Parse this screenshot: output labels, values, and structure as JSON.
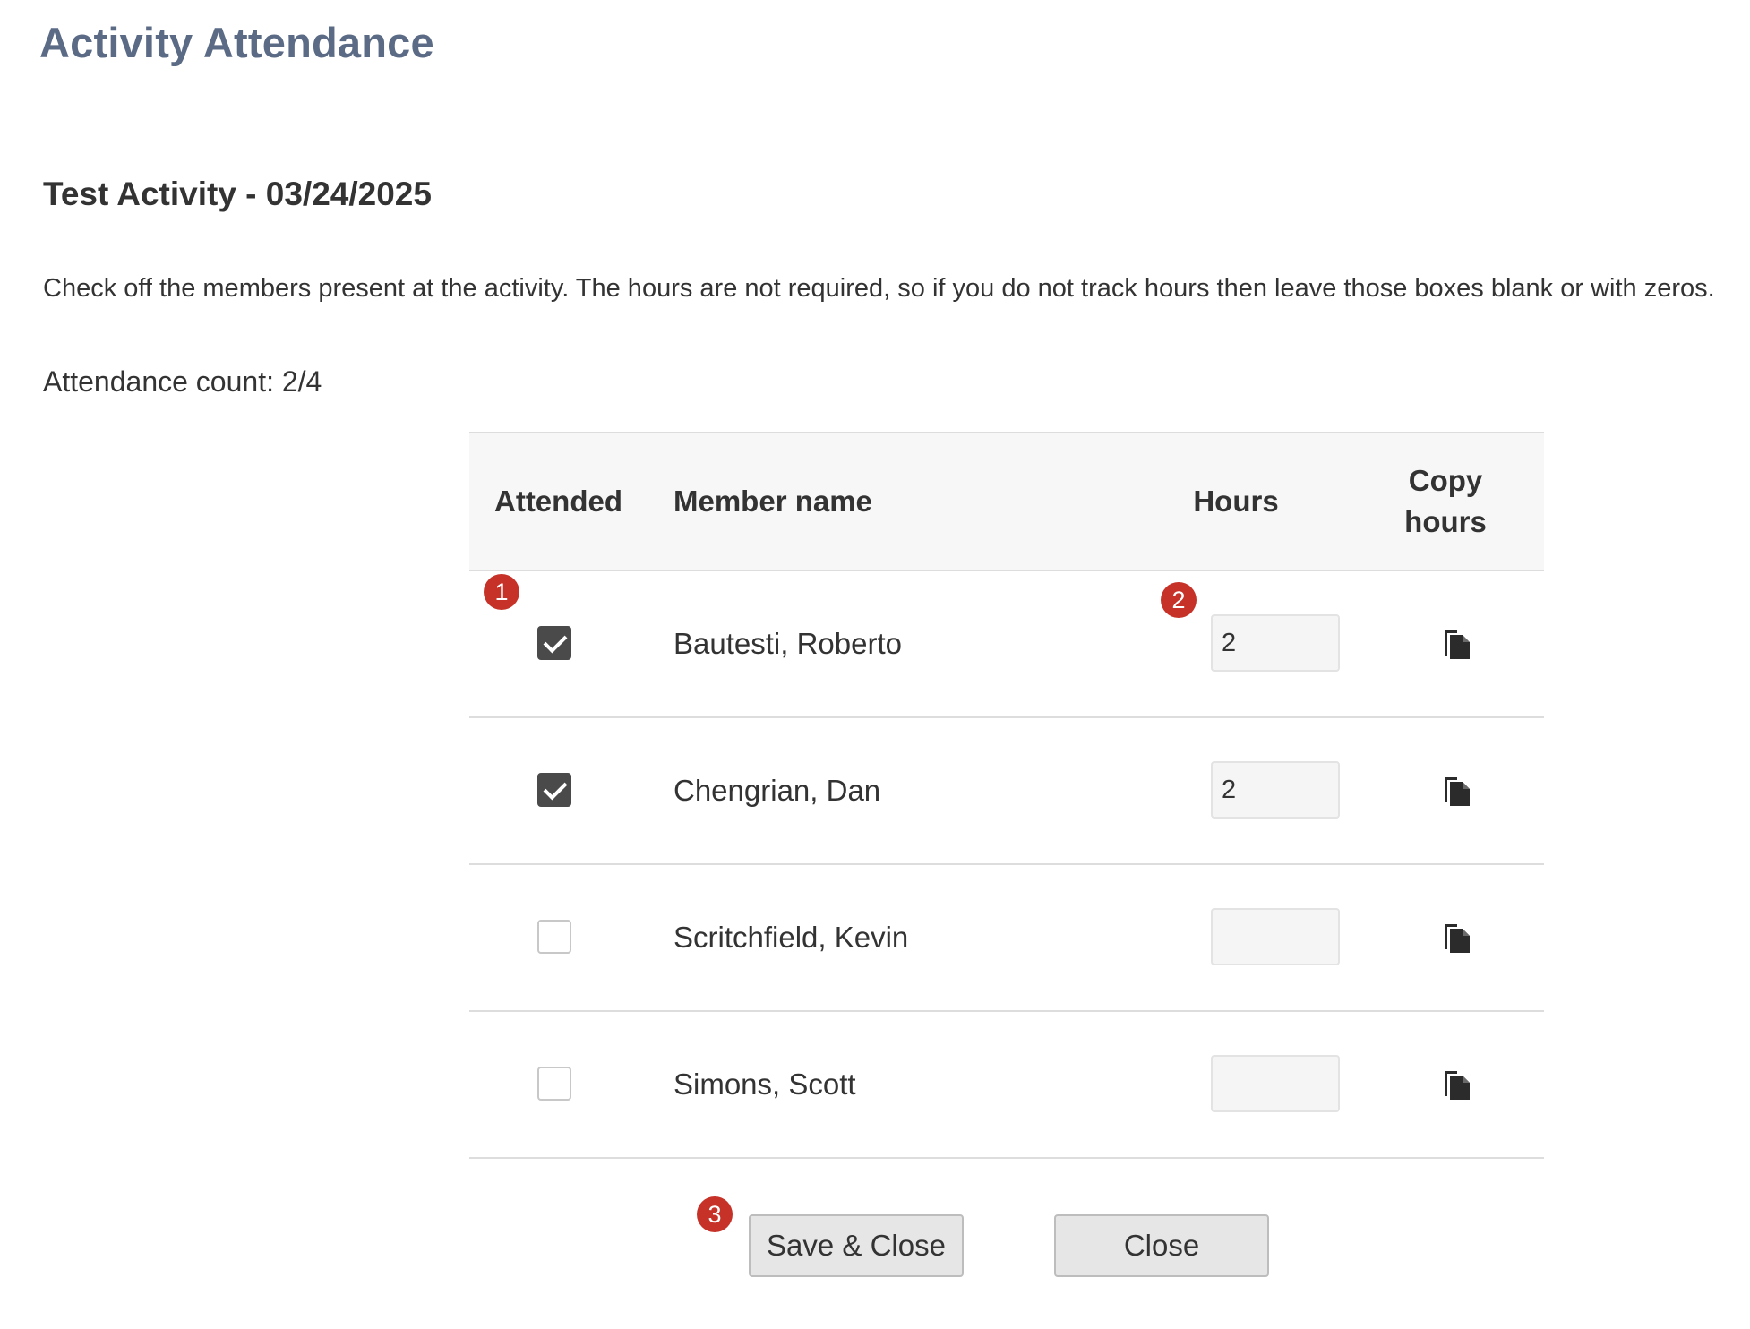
{
  "page": {
    "title": "Activity Attendance"
  },
  "activity": {
    "title": "Test Activity - 03/24/2025",
    "instructions": "Check off the members present at the activity. The hours are not required, so if you do not track hours then leave those boxes blank or with zeros.",
    "attendance_count": "Attendance count: 2/4"
  },
  "table": {
    "headers": {
      "attended": "Attended",
      "member_name": "Member name",
      "hours": "Hours",
      "copy_hours": "Copy hours"
    },
    "rows": [
      {
        "attended": true,
        "member_name": "Bautesti, Roberto",
        "hours": "2"
      },
      {
        "attended": true,
        "member_name": "Chengrian, Dan",
        "hours": "2"
      },
      {
        "attended": false,
        "member_name": "Scritchfield, Kevin",
        "hours": ""
      },
      {
        "attended": false,
        "member_name": "Simons, Scott",
        "hours": ""
      }
    ],
    "copy_icon": "copy-icon"
  },
  "annotations": {
    "badge_1": "1",
    "badge_2": "2",
    "badge_3": "3",
    "badge_color": "#c63228"
  },
  "buttons": {
    "save_close": "Save & Close",
    "close": "Close"
  },
  "colors": {
    "title": "#5b6b86",
    "checkbox_checked": "#4a4a4a",
    "header_bg": "#f7f7f7"
  }
}
